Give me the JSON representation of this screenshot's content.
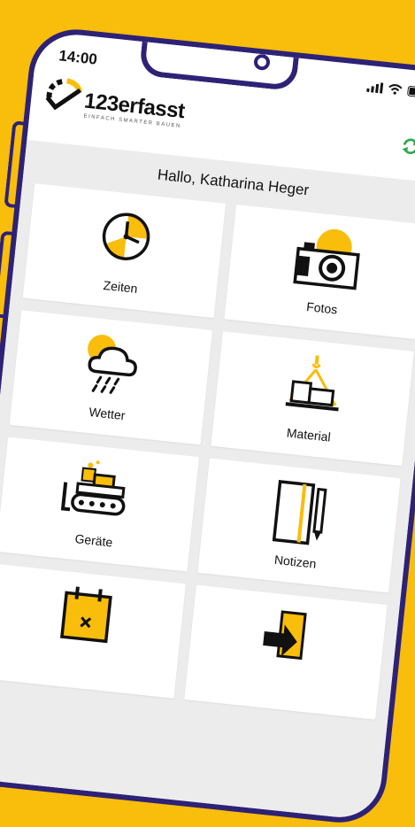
{
  "status_bar": {
    "time": "14:00"
  },
  "header": {
    "brand": "123erfasst",
    "tagline": "EINFACH SMARTER BAUEN"
  },
  "greeting": "Hallo, Katharina Heger",
  "tiles": [
    {
      "label": "Zeiten",
      "icon": "clock-icon"
    },
    {
      "label": "Fotos",
      "icon": "camera-icon"
    },
    {
      "label": "Wetter",
      "icon": "weather-icon"
    },
    {
      "label": "Material",
      "icon": "material-icon"
    },
    {
      "label": "Geräte",
      "icon": "bulldozer-icon"
    },
    {
      "label": "Notizen",
      "icon": "notebook-icon"
    },
    {
      "label": "",
      "icon": "calendar-icon"
    },
    {
      "label": "",
      "icon": "export-icon"
    }
  ],
  "colors": {
    "accent": "#f9bd0b",
    "frame": "#2d2276",
    "sync": "#2aa84a"
  }
}
